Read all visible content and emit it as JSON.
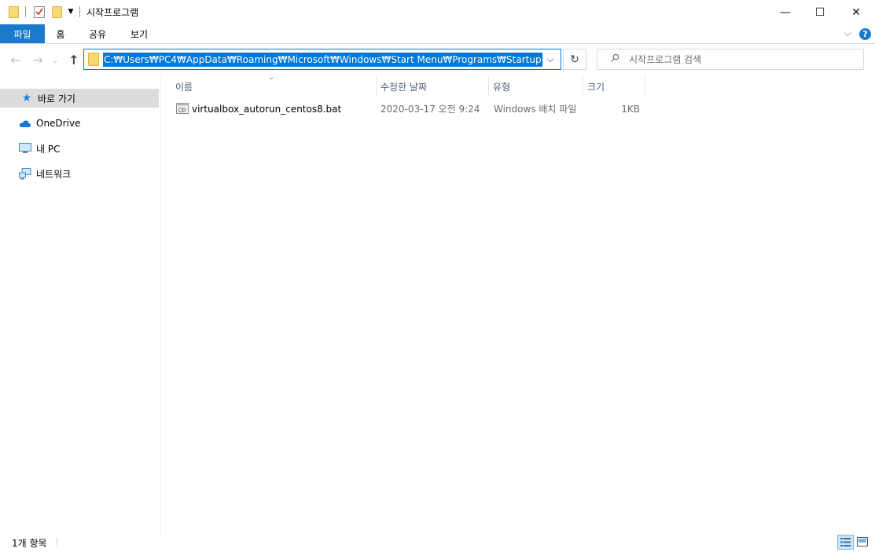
{
  "window": {
    "title": "시작프로그램",
    "minimize_glyph": "—",
    "maximize_glyph": "☐",
    "close_glyph": "✕"
  },
  "ribbon": {
    "tabs": [
      "파일",
      "홈",
      "공유",
      "보기"
    ],
    "expand_glyph": "⌵",
    "help_glyph": "?"
  },
  "navigation": {
    "back_glyph": "←",
    "forward_glyph": "→",
    "recent_glyph": "⌄",
    "up_glyph": "↑"
  },
  "address_bar": {
    "path": "C:₩Users₩PC4₩AppData₩Roaming₩Microsoft₩Windows₩Start Menu₩Programs₩Startup",
    "dropdown_glyph": "⌵",
    "refresh_glyph": "↻"
  },
  "search": {
    "placeholder": "시작프로그램 검색",
    "icon_glyph": "⚲"
  },
  "sidebar": {
    "items": [
      {
        "label": "바로 가기",
        "icon": "star-icon"
      },
      {
        "label": "OneDrive",
        "icon": "cloud-icon"
      },
      {
        "label": "내 PC",
        "icon": "computer-icon"
      },
      {
        "label": "네트워크",
        "icon": "network-icon"
      }
    ]
  },
  "file_list": {
    "sort_glyph": "⌄",
    "columns": [
      "이름",
      "수정한 날짜",
      "유형",
      "크기"
    ],
    "rows": [
      {
        "name": "virtualbox_autorun_centos8.bat",
        "modified": "2020-03-17 오전 9:24",
        "type": "Windows 배치 파일",
        "size": "1KB",
        "icon": "batch-file-icon"
      }
    ]
  },
  "status_bar": {
    "item_count": "1개 항목"
  },
  "colors": {
    "accent": "#0078d7",
    "file_tab": "#1979ca",
    "folder": "#f8d775",
    "header_text": "#4c607a"
  }
}
